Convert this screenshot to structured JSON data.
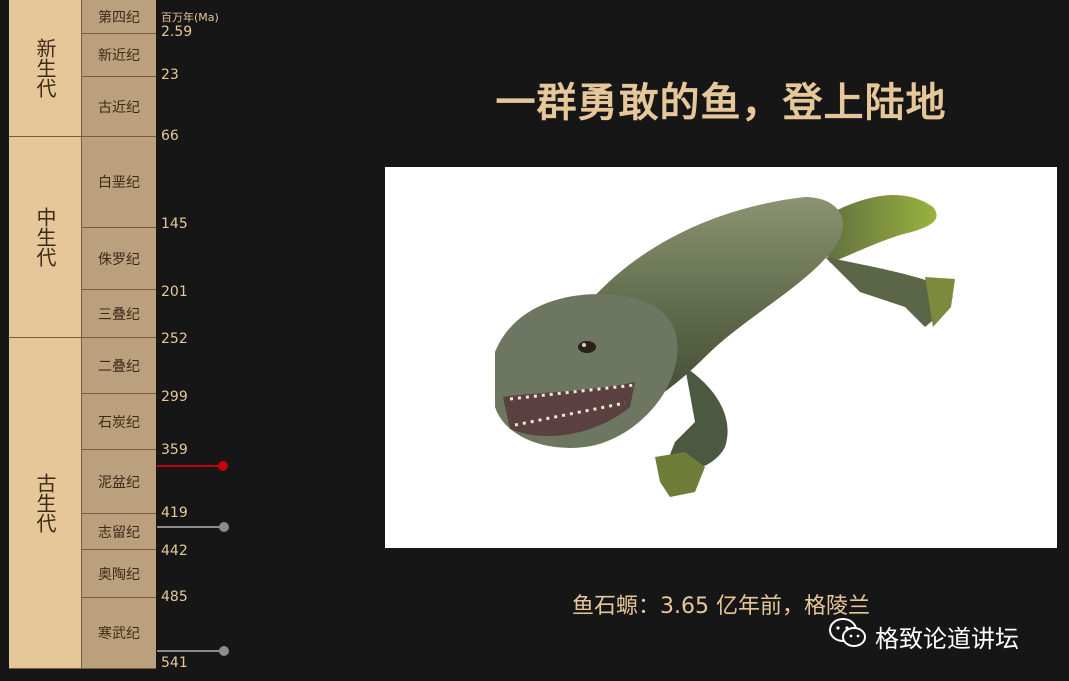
{
  "timeline": {
    "unit": "百万年(Ma)",
    "eras": [
      {
        "label": "新生代"
      },
      {
        "label": "中生代"
      },
      {
        "label": "古生代"
      }
    ],
    "periods": [
      {
        "label": "第四纪"
      },
      {
        "label": "新近纪"
      },
      {
        "label": "古近纪"
      },
      {
        "label": "白垩纪"
      },
      {
        "label": "侏罗纪"
      },
      {
        "label": "三叠纪"
      },
      {
        "label": "二叠纪"
      },
      {
        "label": "石炭纪"
      },
      {
        "label": "泥盆纪"
      },
      {
        "label": "志留纪"
      },
      {
        "label": "奥陶纪"
      },
      {
        "label": "寒武纪"
      }
    ],
    "ages": [
      "2.59",
      "23",
      "66",
      "145",
      "201",
      "252",
      "299",
      "359",
      "419",
      "442",
      "485",
      "541"
    ],
    "markers": [
      {
        "ma": 365,
        "color": "#c8000a"
      },
      {
        "ma": 419,
        "color": "#8c8c8c"
      },
      {
        "ma": 541,
        "color": "#8c8c8c"
      }
    ]
  },
  "title": "一群勇敢的鱼，登上陆地",
  "image": {
    "icon": "tetrapod-illustration"
  },
  "caption": "鱼石螈：3.65 亿年前，格陵兰",
  "watermark": {
    "icon": "wechat-icon",
    "text": "格致论道讲坛"
  },
  "colors": {
    "accent": "#e6c799",
    "background": "#161616",
    "marker_red": "#c8000a"
  }
}
